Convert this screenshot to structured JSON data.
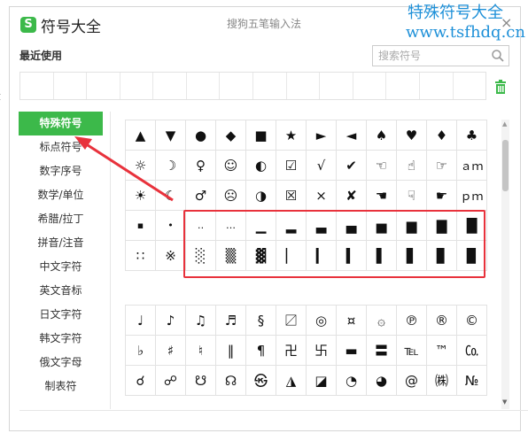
{
  "window": {
    "title": "符号大全",
    "ime_name": "搜狗五笔输入法",
    "close_glyph": "×"
  },
  "watermark": {
    "line1": "特殊符号大全",
    "line2": "www.tsfhdq.cn"
  },
  "recent": {
    "title": "最近使用",
    "search_placeholder": "搜索符号",
    "empty_cells": 14
  },
  "left_edge_char": "大",
  "sidebar": {
    "items": [
      {
        "label": "特殊符号",
        "active": true
      },
      {
        "label": "标点符号"
      },
      {
        "label": "数字序号"
      },
      {
        "label": "数学/单位"
      },
      {
        "label": "希腊/拉丁"
      },
      {
        "label": "拼音/注音"
      },
      {
        "label": "中文字符"
      },
      {
        "label": "英文音标"
      },
      {
        "label": "日文字符"
      },
      {
        "label": "韩文字符"
      },
      {
        "label": "俄文字母"
      },
      {
        "label": "制表符"
      }
    ]
  },
  "symbols": {
    "block1": [
      [
        "▲",
        "▼",
        "●",
        "◆",
        "■",
        "★",
        "►",
        "◄",
        "♠",
        "♥",
        "♦",
        "♣"
      ],
      [
        "☼",
        "☽",
        "♀",
        "☺",
        "◐",
        "☑",
        "√",
        "✔",
        "☜",
        "☝",
        "☞",
        "ａｍ"
      ],
      [
        "☀",
        "☾",
        "♂",
        "☹",
        "◑",
        "☒",
        "×",
        "✘",
        "☚",
        "☟",
        "☛",
        "ｐｍ"
      ],
      [
        "▪",
        "•",
        "‥",
        "…",
        "▁",
        "▂",
        "▃",
        "▄",
        "▅",
        "▆",
        "▇",
        "█"
      ],
      [
        "∷",
        "※",
        "░",
        "▒",
        "▓",
        "▏",
        "▎",
        "▍",
        "▌",
        "▋",
        "▊",
        "▉"
      ]
    ],
    "block2": [
      [
        "♩",
        "♪",
        "♫",
        "♬",
        "§",
        "〼",
        "◎",
        "¤",
        "۞",
        "℗",
        "®",
        "©"
      ],
      [
        "♭",
        "♯",
        "♮",
        "‖",
        "¶",
        "卍",
        "卐",
        "▬",
        "〓",
        "℡",
        "™",
        "㏇"
      ],
      [
        "☌",
        "☍",
        "☋",
        "☊",
        "㉿",
        "◮",
        "◪",
        "◔",
        "◕",
        "@",
        "㈱",
        "№"
      ]
    ]
  },
  "colors": {
    "accent_green": "#3cb94a",
    "annotation_red": "#e8323c",
    "watermark_blue": "#1e90d8"
  },
  "icons": {
    "logo": "sogou-logo-icon",
    "search": "search-icon",
    "trash": "trash-icon",
    "close": "close-icon"
  }
}
